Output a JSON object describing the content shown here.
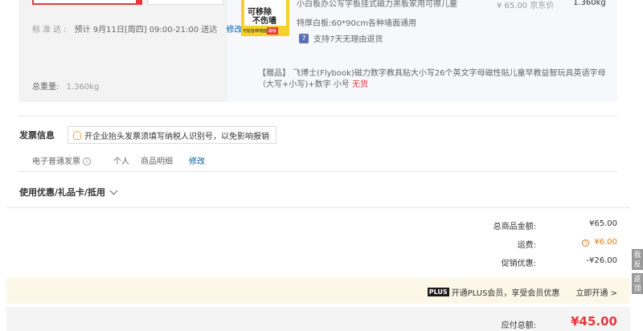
{
  "shipping": {
    "delivery_label": "标准达:",
    "delivery_value": "预计 9月11日[周四] 09:00-21:00 送达",
    "delivery_edit": "修改",
    "total_weight_label": "总重量:",
    "total_weight_value": "1.360kg"
  },
  "product": {
    "image_text_line1": "可移除",
    "image_text_line2": "不伤墙",
    "image_badge1": "可贴各种墙面",
    "image_badge2": "磁吸",
    "name": "小白板办公写字板挂式磁力黑板家用可擦儿童",
    "price": "¥ 65.00 京东价",
    "weight": "1.360kg",
    "spec": "特厚白板:60*90cm各种墙面通用",
    "return_icon": "return-icon",
    "return_policy": "支持7天无理由退货",
    "gift_prefix": "【赠品】",
    "gift_text": "飞博士(Flybook)磁力数字教具贴大小写26个英文字母磁性贴儿童早教益智玩具英语字母（大写+小写)+数字 小号",
    "gift_status": "无货"
  },
  "invoice": {
    "title": "发票信息",
    "tip": "开企业抬头发票须填写纳税人识别号，以免影响报销",
    "type": "电子普通发票",
    "title_type": "个人",
    "content": "商品明细",
    "edit": "修改"
  },
  "coupon": {
    "label": "使用优惠/礼品卡/抵用"
  },
  "totals": {
    "goods_label": "总商品金额:",
    "goods_value": "¥65.00",
    "shipping_label": "运费:",
    "shipping_value": "¥6.00",
    "discount_label": "促销优惠:",
    "discount_value": "-¥26.00"
  },
  "plus": {
    "badge": "PLUS",
    "text": "开通PLUS会员，享受会员优惠",
    "link": "立即开通 >"
  },
  "payable": {
    "label": "应付总额:",
    "value": "¥45.00"
  },
  "side": {
    "tab1": "我反",
    "tab2": "返顶"
  },
  "colors": {
    "accent_red": "#e4393c",
    "link_blue": "#005ea7",
    "shipping_orange": "#e47911"
  }
}
